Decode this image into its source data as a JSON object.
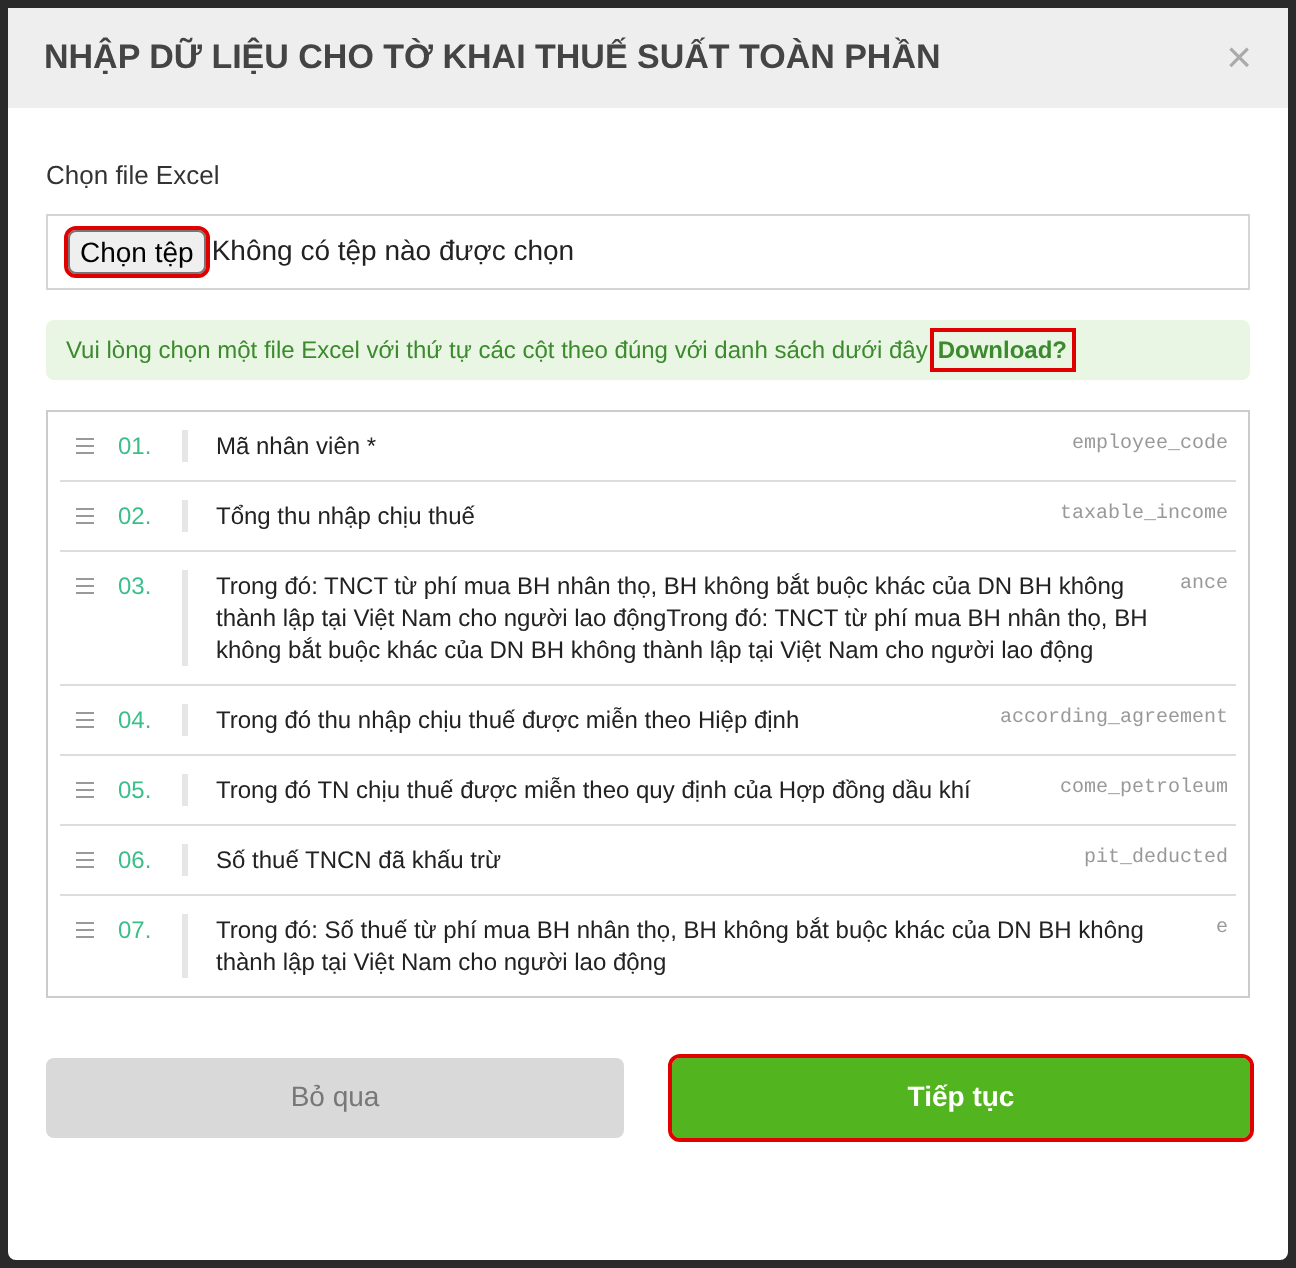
{
  "dialog": {
    "title": "NHẬP DỮ LIỆU CHO TỜ KHAI THUẾ SUẤT TOÀN PHẦN",
    "close": "×"
  },
  "file": {
    "label": "Chọn file Excel",
    "button": "Chọn tệp",
    "status": "Không có tệp nào được chọn",
    "highlighted": true
  },
  "notice": {
    "text": "Vui lòng chọn một file Excel với thứ tự các cột theo đúng với danh sách dưới đây",
    "link": "Download?",
    "highlighted": true
  },
  "columns": [
    {
      "number": "01.",
      "label": "Mã nhân viên *",
      "code": "employee_code"
    },
    {
      "number": "02.",
      "label": "Tổng thu nhập chịu thuế",
      "code": "taxable_income"
    },
    {
      "number": "03.",
      "label": "Trong đó: TNCT từ phí mua BH nhân thọ, BH không bắt buộc khác của DN BH không thành lập tại Việt Nam cho người lao độngTrong đó: TNCT từ phí mua BH nhân thọ, BH không bắt buộc khác của DN BH không thành lập tại Việt Nam cho người lao động",
      "code": "ance"
    },
    {
      "number": "04.",
      "label": "Trong đó thu nhập chịu thuế được miễn theo Hiệp định",
      "code": "according_agreement"
    },
    {
      "number": "05.",
      "label": "Trong đó TN chịu thuế được miễn theo quy định của Hợp đồng dầu khí",
      "code": "come_petroleum"
    },
    {
      "number": "06.",
      "label": "Số thuế TNCN đã khấu trừ",
      "code": "pit_deducted"
    },
    {
      "number": "07.",
      "label": "Trong đó: Số thuế từ phí mua BH nhân thọ, BH không bắt buộc khác của DN BH không thành lập tại Việt Nam cho người lao động",
      "code": "e"
    }
  ],
  "buttons": [
    {
      "label": "Bỏ qua",
      "kind": "secondary",
      "highlighted": false
    },
    {
      "label": "Tiếp tục",
      "kind": "primary",
      "highlighted": true
    }
  ]
}
